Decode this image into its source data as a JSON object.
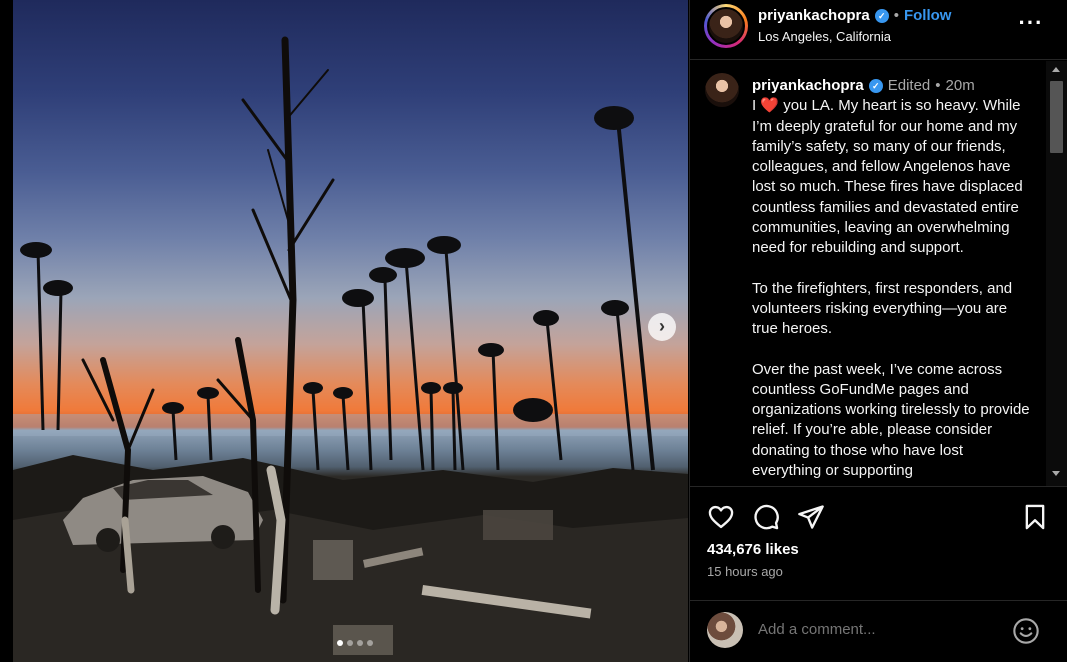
{
  "post": {
    "username": "priyankachopra",
    "follow_label": "Follow",
    "location": "Los Angeles, California",
    "separator": "•",
    "more_icon": "more-horizontal-icon"
  },
  "caption": {
    "username": "priyankachopra",
    "edited_label": "Edited",
    "separator": "•",
    "time": "20m",
    "line_prefix": "I",
    "heart_emoji": "❤️",
    "line_suffix": "you LA. My heart is so heavy. While I’m deeply grateful for our home and my family’s safety, so many of our friends, colleagues, and fellow Angelenos have lost so much. These fires have displaced countless families and devastated entire communities, leaving an overwhelming need for rebuilding and support.",
    "paragraph_2": "To the firefighters, first responders, and volunteers risking everything—you are true heroes.",
    "paragraph_3": "Over the past week, I’ve come across countless GoFundMe pages and organizations working tirelessly to provide relief. If you’re able, please consider donating to those who have lost everything or supporting"
  },
  "actions": {
    "icons": [
      "heart-icon",
      "comment-icon",
      "share-icon",
      "bookmark-icon"
    ],
    "likes": "434,676 likes",
    "posted": "15 hours ago"
  },
  "comment": {
    "placeholder": "Add a comment..."
  },
  "carousel": {
    "dot_count": 4,
    "active_index": 0
  },
  "colors": {
    "accent": "#3897f0",
    "background": "#000000",
    "secondary_text": "#a8a8a8"
  }
}
